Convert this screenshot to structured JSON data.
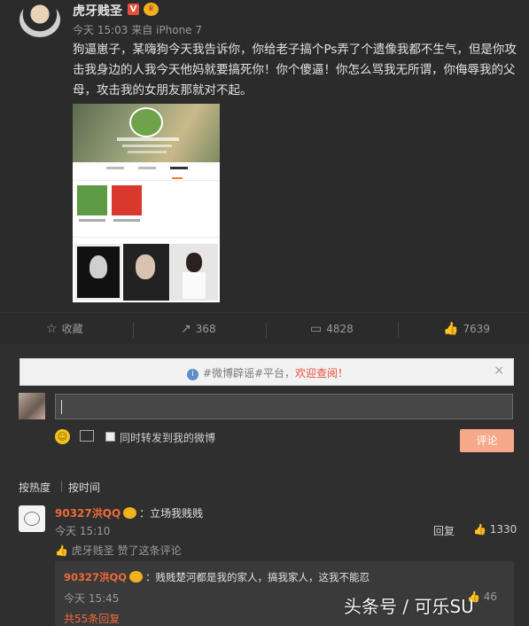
{
  "post": {
    "author": "虎牙贱圣",
    "verified_badge": "V",
    "time": "今天 15:03",
    "source": "来自 iPhone 7",
    "text": "狗逼崽子，某嗨狗今天我告诉你，你给老子搞个Ps弄了个遗像我都不生气，但是你攻击我身边的人我今天他妈就要搞死你！你个傻逼！你怎么骂我无所谓，你侮辱我的父母，攻击我的女朋友那就对不起。"
  },
  "actions": {
    "favorite": "收藏",
    "repost_count": "368",
    "comment_count": "4828",
    "like_count": "7639"
  },
  "comment_box": {
    "notice_prefix": "#微博辟谣#平台，",
    "notice_link": "欢迎查阅！",
    "close_glyph": "×",
    "repost_label": "同时转发到我的微博",
    "submit_label": "评论"
  },
  "sort": {
    "by_hot": "按热度",
    "by_time": "按时间"
  },
  "comment": {
    "user": "90327洪QQ",
    "text": "：立场我贱贱",
    "time": "今天 15:10",
    "reply_label": "回复",
    "like_count": "1330",
    "liked_by_user": "虎牙贱圣",
    "liked_by_text": "赞了这条评论",
    "reply": {
      "user": "90327洪QQ",
      "text": "：贱贱楚河都是我的家人，搞我家人，这我不能忍",
      "time": "今天 15:45",
      "like_count": "46",
      "more": "共55条回复"
    }
  },
  "watermark": "头条号 / 可乐SU",
  "colors": {
    "accent": "#ee6a3a",
    "background": "#2f2f2f",
    "submit": "#f5a98a"
  }
}
